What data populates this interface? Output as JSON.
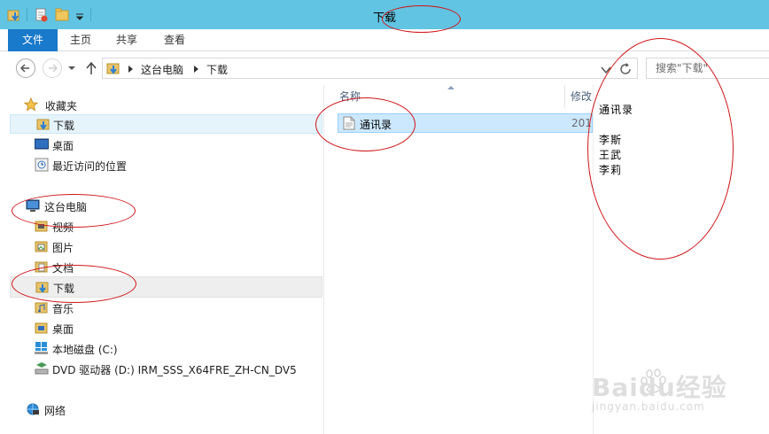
{
  "window": {
    "title": "下载"
  },
  "ribbon": {
    "tabs": [
      "文件",
      "主页",
      "共享",
      "查看"
    ]
  },
  "address": {
    "breadcrumbs": [
      "这台电脑",
      "下载"
    ]
  },
  "search": {
    "placeholder": "搜索\"下载\""
  },
  "nav": {
    "favorites": {
      "header": "收藏夹",
      "items": [
        "下载",
        "桌面",
        "最近访问的位置"
      ]
    },
    "this_pc": {
      "header": "这台电脑",
      "items": [
        "视频",
        "图片",
        "文档",
        "下载",
        "音乐",
        "桌面",
        "本地磁盘 (C:)",
        "DVD 驱动器 (D:) IRM_SSS_X64FRE_ZH-CN_DV5"
      ]
    },
    "network": {
      "header": "网络"
    }
  },
  "filelist": {
    "columns": [
      "名称",
      "修改"
    ],
    "rows": [
      {
        "name": "通讯录",
        "date": "201"
      }
    ]
  },
  "preview": {
    "title": "通讯录",
    "lines": [
      "李斯",
      "王武",
      "李莉"
    ]
  },
  "watermark": {
    "brand": "Baidu经验",
    "url": "jingyan.baidu.com"
  },
  "colors": {
    "titlebar": "#61c4e3",
    "file_tab": "#1979ca",
    "selection": "#cce8ff",
    "annotation": "#d0161a"
  }
}
